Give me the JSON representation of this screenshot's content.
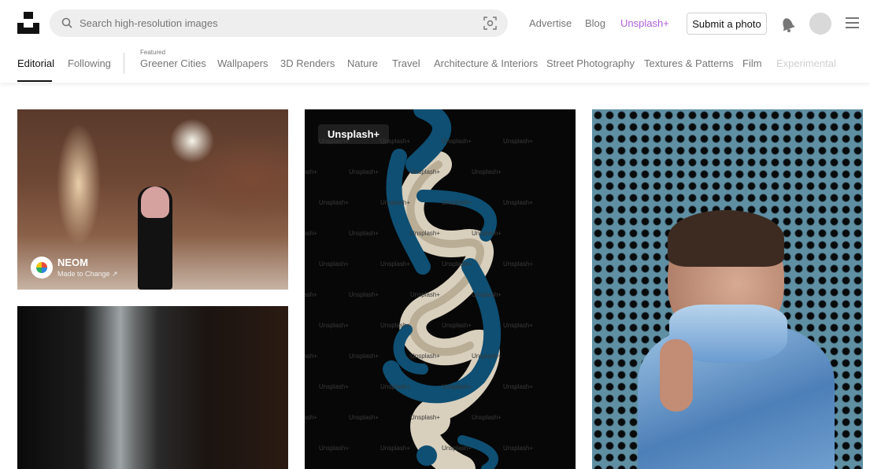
{
  "header": {
    "search_placeholder": "Search high-resolution images",
    "links": [
      "Advertise",
      "Blog",
      "Unsplash+"
    ],
    "submit_label": "Submit a photo"
  },
  "tabs": {
    "items": [
      "Editorial",
      "Following",
      "Greener Cities",
      "Wallpapers",
      "3D Renders",
      "Nature",
      "Travel",
      "Architecture & Interiors",
      "Street Photography",
      "Textures & Patterns",
      "Film",
      "Experimental"
    ],
    "featured_caption": "Featured",
    "active": "Editorial"
  },
  "photos": {
    "first": {
      "brand_name": "NEOM",
      "brand_tagline": "Made to Change ↗"
    },
    "third": {
      "badge": "Unsplash+",
      "watermark": "Unsplash+"
    }
  },
  "colors": {
    "unsplash_plus": "#b15fd8",
    "text_muted": "#767676",
    "search_bg": "#eeeeee"
  },
  "icons": [
    "unsplash-logo-icon",
    "search-icon",
    "visual-search-icon",
    "bell-icon",
    "avatar",
    "menu-icon",
    "neom-logo-icon"
  ]
}
